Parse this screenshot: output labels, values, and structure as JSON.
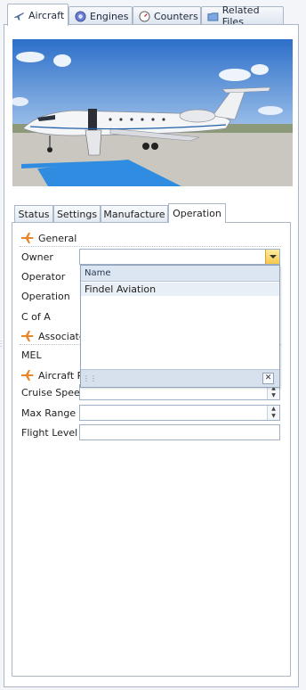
{
  "top_tabs": [
    {
      "label": "Aircraft",
      "icon": "airplane-icon",
      "active": true
    },
    {
      "label": "Engines",
      "icon": "engine-icon",
      "active": false
    },
    {
      "label": "Counters",
      "icon": "gauge-icon",
      "active": false
    },
    {
      "label": "Related Files",
      "icon": "folder-icon",
      "active": false
    }
  ],
  "inner_tabs": [
    {
      "label": "Status"
    },
    {
      "label": "Settings"
    },
    {
      "label": "Manufacture"
    },
    {
      "label": "Operation",
      "active": true
    }
  ],
  "sections": {
    "general": "General",
    "associated": "Associated",
    "performance": "Aircraft Pe"
  },
  "fields": {
    "owner": {
      "label": "Owner",
      "value": ""
    },
    "operator": {
      "label": "Operator"
    },
    "operation": {
      "label": "Operation"
    },
    "c_of_a": {
      "label": "C of A"
    },
    "mel": {
      "label": "MEL"
    },
    "cruise_speed": {
      "label": "Cruise Speed",
      "value": ""
    },
    "max_range": {
      "label": "Max Range",
      "value": ""
    },
    "flight_level": {
      "label": "Flight Level",
      "value": ""
    }
  },
  "owner_dropdown": {
    "column_header": "Name",
    "options": [
      "Findel Aviation"
    ]
  },
  "colors": {
    "accent_orange": "#e8862a",
    "border_blue": "#a9b7c9",
    "highlight_row": "#e9eff7"
  }
}
